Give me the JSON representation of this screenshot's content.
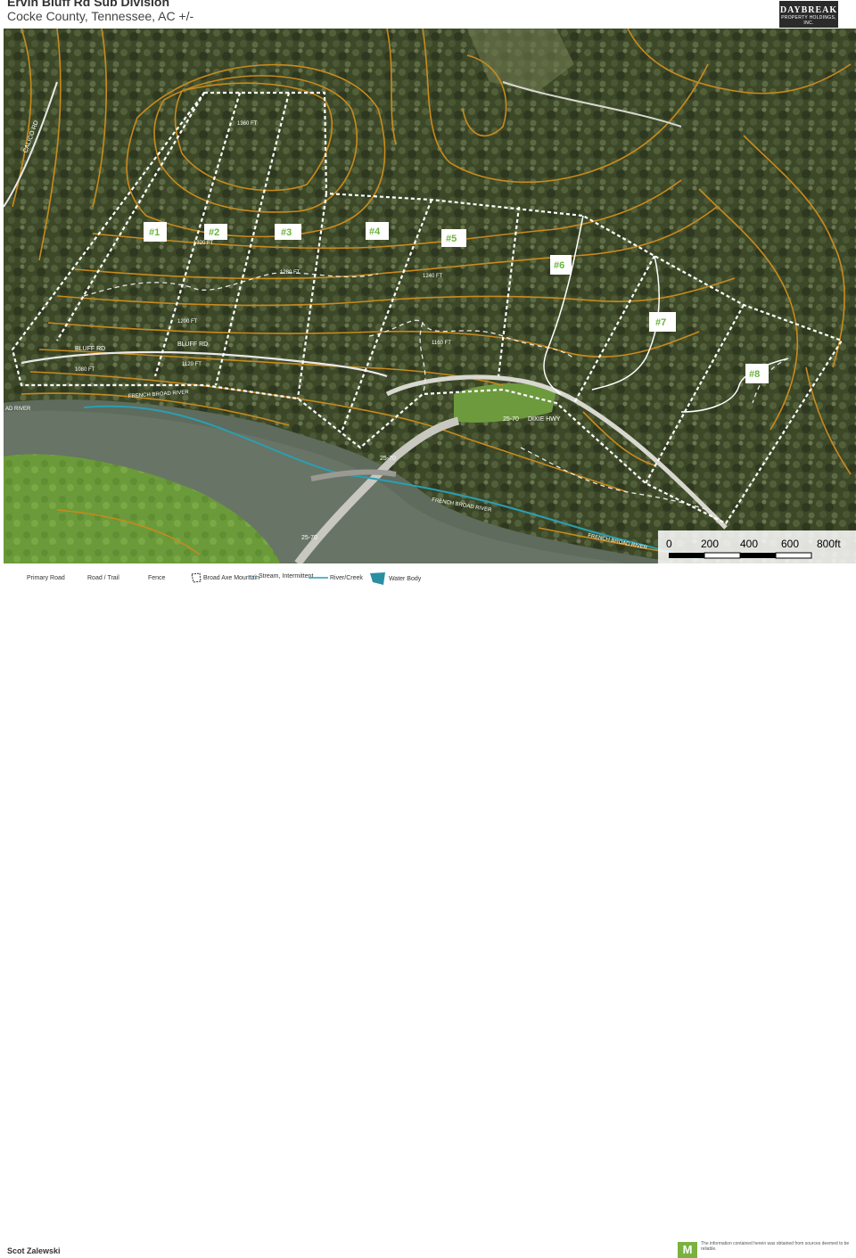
{
  "header": {
    "title": "Ervin Bluff Rd Sub Division",
    "subtitle": "Cocke County, Tennessee,  AC +/-",
    "logo_main": "DAYBREAK",
    "logo_sub": "PROPERTY HOLDINGS, INC."
  },
  "lots": [
    "#1",
    "#2",
    "#3",
    "#4",
    "#5",
    "#6",
    "#7",
    "#8"
  ],
  "contours": [
    "1360 FT",
    "1320 FT",
    "1280 FT",
    "1240 FT",
    "1200 FT",
    "1160 FT",
    "1120 FT",
    "1080 FT"
  ],
  "roads": [
    "BLUFF RD",
    "BLUFF RD",
    "DIXIE HWY",
    "CALICO RD",
    "25-70",
    "25-70",
    "25-70"
  ],
  "rivers": [
    "FRENCH BROAD RIVER",
    "FRENCH BROAD RIVER",
    "FRENCH BROAD RIVER",
    "AD RIVER"
  ],
  "scale": {
    "ticks": [
      "0",
      "200",
      "400",
      "600",
      "800ft"
    ]
  },
  "legend": [
    {
      "label": "Primary Road",
      "icon": "primary-road-icon"
    },
    {
      "label": "Road / Trail",
      "icon": "road-trail-icon"
    },
    {
      "label": "Fence",
      "icon": "fence-icon"
    },
    {
      "label": "Broad Axe Mountain",
      "icon": "boundary-icon"
    },
    {
      "label": "Stream, Intermittent",
      "icon": "stream-icon"
    },
    {
      "label": "River/Creek",
      "icon": "river-creek-icon"
    },
    {
      "label": "Water Body",
      "icon": "water-body-icon"
    }
  ],
  "footer": {
    "agent": "Scot Zalewski",
    "logo_letter": "M",
    "disclaimer": "The information contained herein was obtained from sources deemed to be reliable."
  },
  "colors": {
    "contour": "#c98a1c",
    "lot_label": "#6bb33e",
    "river_line": "#2a9fb3",
    "forest": "#3f4a2a"
  }
}
